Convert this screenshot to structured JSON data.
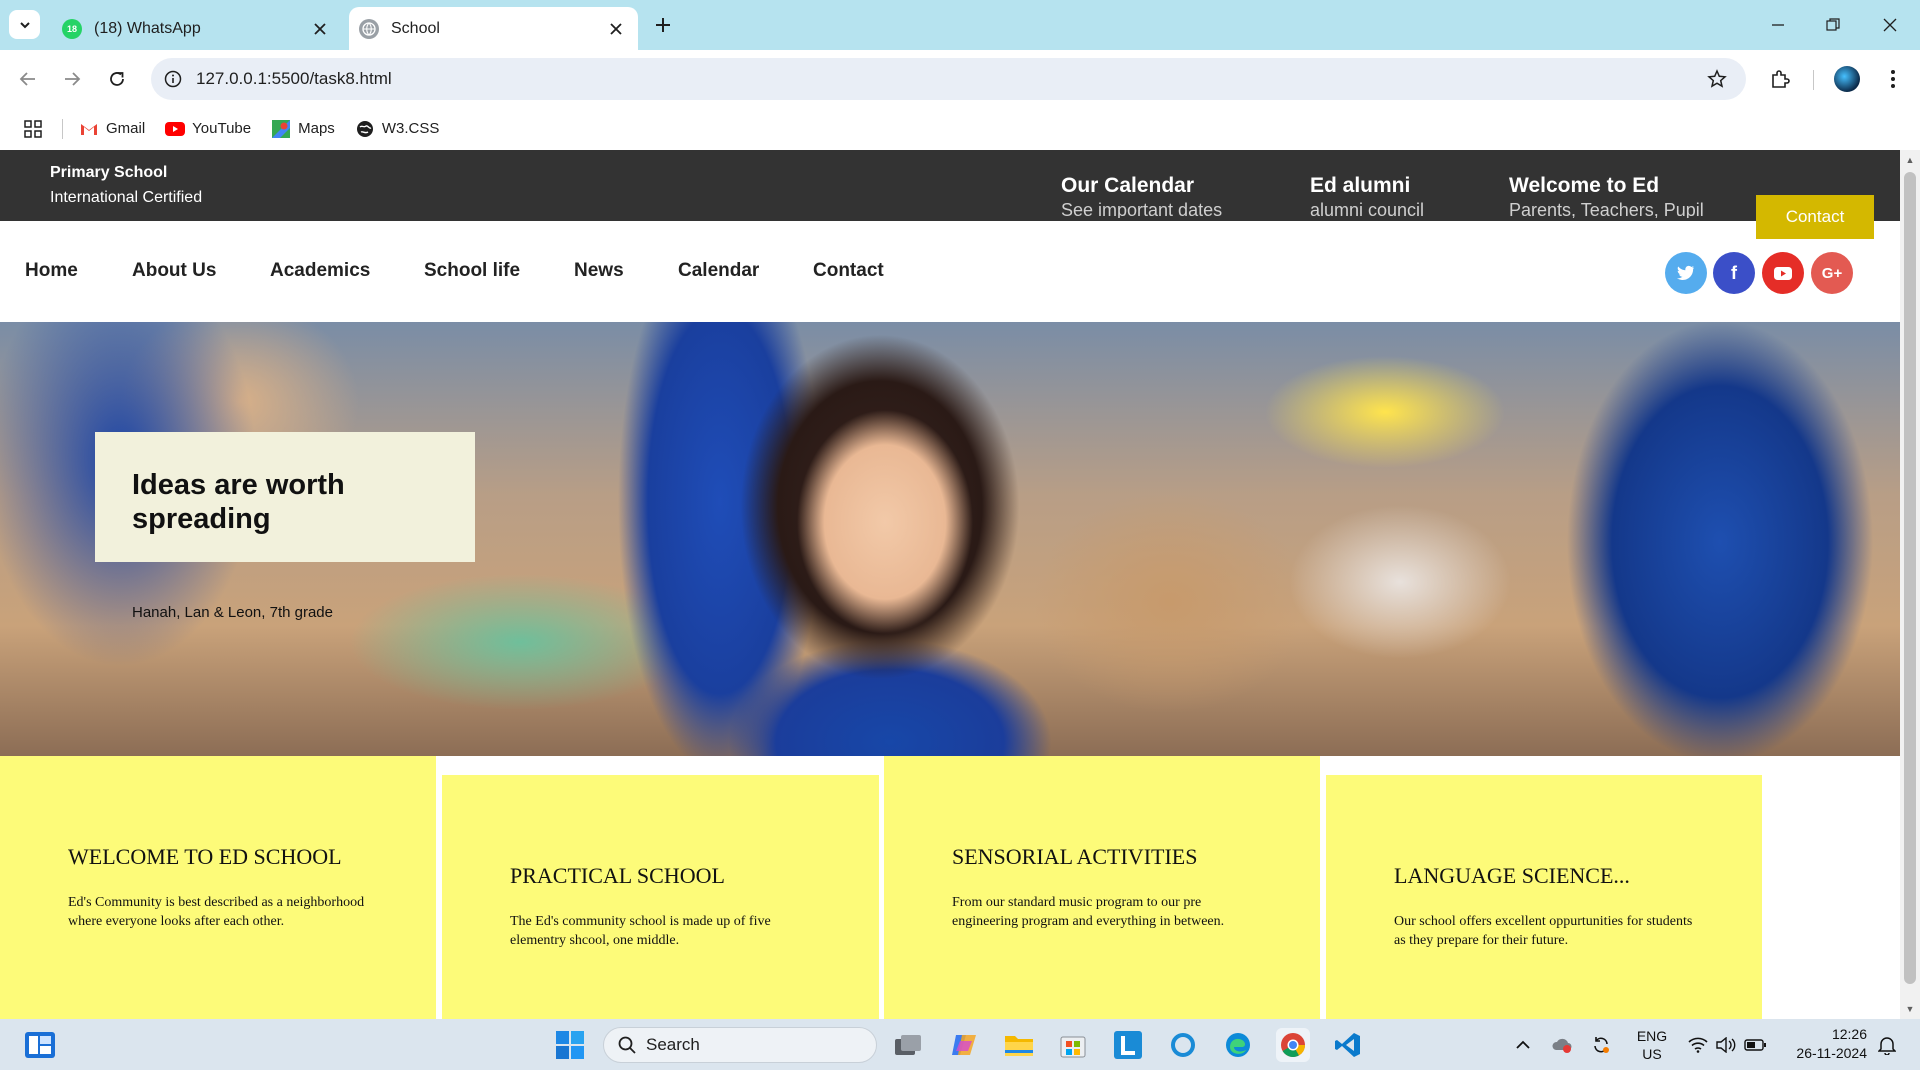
{
  "browser": {
    "tabs": [
      {
        "title": "(18) WhatsApp",
        "badge": "18",
        "favicon": "whatsapp-icon",
        "active": false
      },
      {
        "title": "School",
        "favicon": "globe-icon",
        "active": true
      }
    ],
    "url": "127.0.0.1:5500/task8.html",
    "bookmarks": [
      {
        "label": "Gmail",
        "icon": "gmail-icon"
      },
      {
        "label": "YouTube",
        "icon": "youtube-icon"
      },
      {
        "label": "Maps",
        "icon": "maps-icon"
      },
      {
        "label": "W3.CSS",
        "icon": "globe-icon"
      }
    ]
  },
  "page": {
    "topbar": {
      "school_name": "Primary School",
      "school_sub": "International Certified",
      "links": [
        {
          "title": "Our Calendar",
          "sub": "See important dates"
        },
        {
          "title": "Ed alumni",
          "sub": "alumni council"
        },
        {
          "title": "Welcome to Ed",
          "sub": "Parents, Teachers, Pupil"
        }
      ],
      "contact_label": "Contact"
    },
    "nav": {
      "items": [
        "Home",
        "About Us",
        "Academics",
        "School life",
        "News",
        "Calendar",
        "Contact"
      ],
      "social": [
        {
          "icon": "twitter-icon",
          "glyph": "t",
          "color": "#55acee"
        },
        {
          "icon": "facebook-icon",
          "glyph": "f",
          "color": "#3b5998"
        },
        {
          "icon": "youtube-icon",
          "glyph": "▶",
          "color": "#e52d27"
        },
        {
          "icon": "google-plus-icon",
          "glyph": "G+",
          "color": "#dd4b39"
        }
      ]
    },
    "hero": {
      "title": "Ideas are worth spreading",
      "caption": "Hanah, Lan & Leon, 7th grade"
    },
    "cards": [
      {
        "title": "WELCOME TO ED SCHOOL",
        "text": "Ed's Community is best described as a neighborhood where everyone looks after each other."
      },
      {
        "title": "PRACTICAL SCHOOL",
        "text": "The Ed's community school is made up of five elementry shcool, one middle."
      },
      {
        "title": "SENSORIAL ACTIVITIES",
        "text": "From our standard music program to our pre engineering program and everything in between."
      },
      {
        "title": "LANGUAGE SCIENCE...",
        "text": "Our school offers excellent oppurtunities for students as they prepare for their future."
      }
    ],
    "colors": {
      "topbar": "#333333",
      "accent": "#d4b800",
      "card": "#fdfb79",
      "hero_card": "#f2f1dc"
    }
  },
  "taskbar": {
    "search_placeholder": "Search",
    "lang": "ENG",
    "region": "US",
    "time": "12:26",
    "date": "26-11-2024"
  }
}
